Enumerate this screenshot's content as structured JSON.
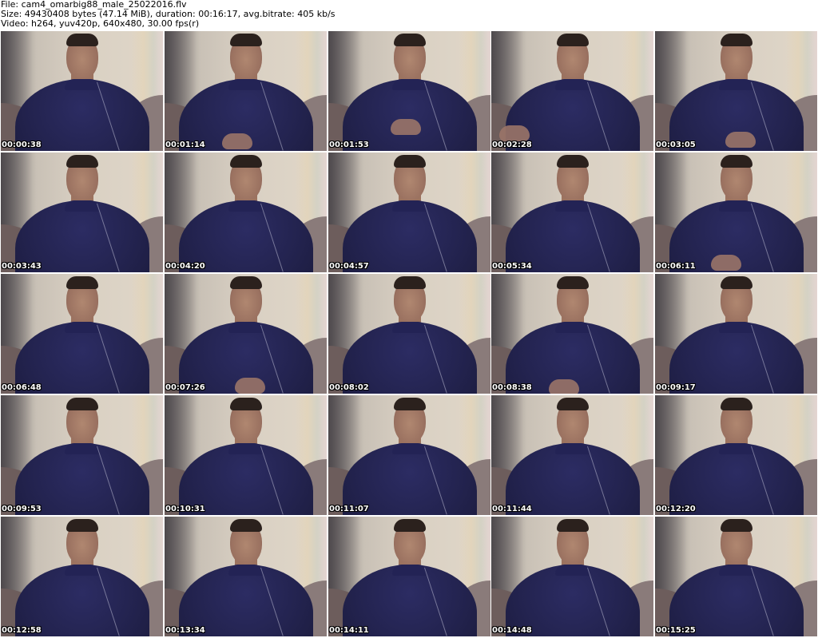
{
  "header": {
    "file_line": "File: cam4_omarbig88_male_25022016.flv",
    "size_line": "Size: 49430408 bytes (47.14 MiB), duration: 00:16:17, avg.bitrate: 405 kb/s",
    "video_line": "Video: h264, yuv420p, 640x480, 30.00 fps(r)"
  },
  "thumbnails": [
    {
      "timestamp": "00:00:38"
    },
    {
      "timestamp": "00:01:14"
    },
    {
      "timestamp": "00:01:53"
    },
    {
      "timestamp": "00:02:28"
    },
    {
      "timestamp": "00:03:05"
    },
    {
      "timestamp": "00:03:43"
    },
    {
      "timestamp": "00:04:20"
    },
    {
      "timestamp": "00:04:57"
    },
    {
      "timestamp": "00:05:34"
    },
    {
      "timestamp": "00:06:11"
    },
    {
      "timestamp": "00:06:48"
    },
    {
      "timestamp": "00:07:26"
    },
    {
      "timestamp": "00:08:02"
    },
    {
      "timestamp": "00:08:38"
    },
    {
      "timestamp": "00:09:17"
    },
    {
      "timestamp": "00:09:53"
    },
    {
      "timestamp": "00:10:31"
    },
    {
      "timestamp": "00:11:07"
    },
    {
      "timestamp": "00:11:44"
    },
    {
      "timestamp": "00:12:20"
    },
    {
      "timestamp": "00:12:58"
    },
    {
      "timestamp": "00:13:34"
    },
    {
      "timestamp": "00:14:11"
    },
    {
      "timestamp": "00:14:48"
    },
    {
      "timestamp": "00:15:25"
    }
  ]
}
